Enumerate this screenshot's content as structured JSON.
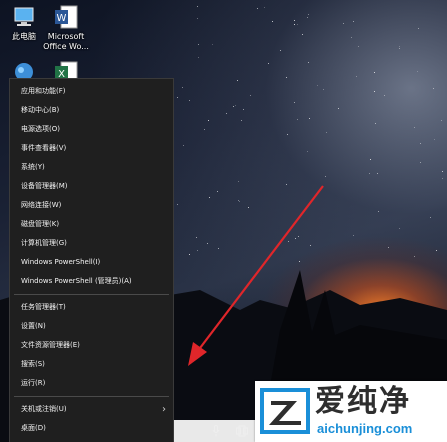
{
  "desktop_icons": [
    {
      "label": "此电脑",
      "icon": "computer-icon"
    },
    {
      "label": "Microsoft Office Wo...",
      "icon": "word-icon"
    },
    {
      "label": "",
      "icon": "network-icon"
    },
    {
      "label": "",
      "icon": "excel-icon"
    }
  ],
  "winx_menu": {
    "group1": [
      {
        "label": "应用和功能(F)"
      },
      {
        "label": "移动中心(B)"
      },
      {
        "label": "电源选项(O)"
      },
      {
        "label": "事件查看器(V)"
      },
      {
        "label": "系统(Y)"
      },
      {
        "label": "设备管理器(M)"
      },
      {
        "label": "网络连接(W)"
      },
      {
        "label": "磁盘管理(K)"
      },
      {
        "label": "计算机管理(G)"
      },
      {
        "label": "Windows PowerShell(I)"
      },
      {
        "label": "Windows PowerShell (管理员)(A)"
      }
    ],
    "group2": [
      {
        "label": "任务管理器(T)"
      },
      {
        "label": "设置(N)"
      },
      {
        "label": "文件资源管理器(E)"
      },
      {
        "label": "搜索(S)"
      },
      {
        "label": "运行(R)"
      }
    ],
    "group3": [
      {
        "label": "关机或注销(U)",
        "submenu_glyph": "›"
      },
      {
        "label": "桌面(D)"
      }
    ]
  },
  "watermark": {
    "title": "爱纯净",
    "url": "aichunjing.com"
  },
  "colors": {
    "menu_bg": "#1f1f1f",
    "arrow": "#e0262a",
    "watermark_accent": "#1a8fd8"
  }
}
